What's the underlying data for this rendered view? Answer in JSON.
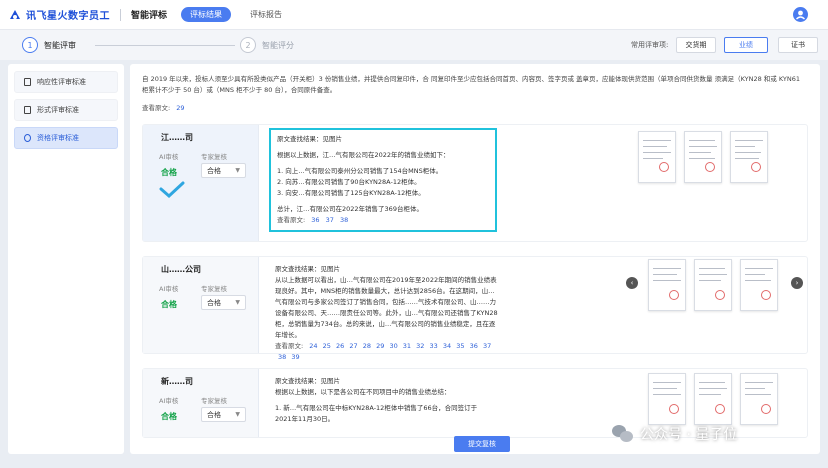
{
  "header": {
    "logo_text": "讯飞星火数字员工",
    "app_name": "智能评标",
    "tabs": [
      {
        "label": "评标结果",
        "active": true
      },
      {
        "label": "评标报告",
        "active": false
      }
    ]
  },
  "steps": [
    {
      "num": "1",
      "label": "智能评审",
      "active": true
    },
    {
      "num": "2",
      "label": "智能评分",
      "active": false
    }
  ],
  "common_terms": {
    "label": "常用评审项:",
    "options": [
      {
        "label": "交货期",
        "active": false
      },
      {
        "label": "业绩",
        "active": true
      },
      {
        "label": "证书",
        "active": false
      }
    ]
  },
  "sidebar": {
    "items": [
      {
        "label": "响应性评审标准",
        "active": false
      },
      {
        "label": "形式评审标准",
        "active": false
      },
      {
        "label": "资格评审标准",
        "active": true
      }
    ]
  },
  "main": {
    "description": "自 2019 年以来，投标人须至少具有所投类似产品（开关柜）3 份销售业绩，并提供合同复印件，合 同复印件至少应包括合同首页、内容页、签字页或 盖章页，应能体现供货范围（单项合同供货数量 须满足（KYN28 和或 KYN61 柜累计不少于 50 台）或（MNS 柜不少于 80 台），合同原件备查。",
    "review_count_label": "查看原文:",
    "review_count": "29",
    "cards": [
      {
        "company": "江……司",
        "ai_label": "AI审核",
        "expert_label": "专家复核",
        "ai_result": "合格",
        "expert_result": "合格",
        "content_title": "原文查找结果：见图片",
        "paragraphs": [
          "根据以上数据，江…气有限公司在2022年的销售业绩如下：",
          "1. 向上…气有限公司泰州分公司销售了154台MNS柜体。",
          "2. 向苏…有限公司销售了90台KYN28A-12柜体。",
          "3. 向安…有限公司销售了125台KYN28A-12柜体。",
          "总计，江…有限公司在2022年销售了369台柜体。"
        ],
        "ref_label": "查看原文:",
        "refs": [
          "36",
          "37",
          "38"
        ]
      },
      {
        "company": "山……公司",
        "ai_label": "AI审核",
        "expert_label": "专家复核",
        "ai_result": "合格",
        "expert_result": "合格",
        "content_title": "原文查找结果：见图片",
        "paragraphs": [
          "从以上数据可以看出，山…气有限公司在2019年至2022年期间的销售业绩表现良好。其中，MNS柜的销售数量最大，总计达到2856台。在这期间，山…气有限公司与多家公司签订了销售合同，包括……气技术有限公司、山……力设备有限公司、天……限责任公司等。此外，山…气有限公司还销售了KYN28柜，总销售量为734台。总的来说，山…气有限公司的销售业绩稳定，且在逐年增长。"
        ],
        "ref_label": "查看原文:",
        "refs": [
          "24",
          "25",
          "26",
          "27",
          "28",
          "29",
          "30",
          "31",
          "32",
          "33",
          "34",
          "35",
          "36",
          "37",
          "38",
          "39"
        ]
      },
      {
        "company": "新……司",
        "ai_label": "AI审核",
        "expert_label": "专家复核",
        "ai_result": "合格",
        "expert_result": "合格",
        "content_title": "原文查找结果：见图片",
        "paragraphs": [
          "根据以上数据，以下是各公司在不同项目中的销售业绩总结：",
          "1. 新…气有限公司在中标KYN28A-12柜体中销售了66台，合同签订于2021年11月30日。"
        ],
        "ref_label": "",
        "refs": []
      }
    ],
    "submit_label": "提交复核"
  },
  "watermark": "公众号 · 量子位",
  "colors": {
    "primary": "#4a7cf0",
    "success": "#15a34a",
    "highlight_border": "#20c2dc"
  }
}
